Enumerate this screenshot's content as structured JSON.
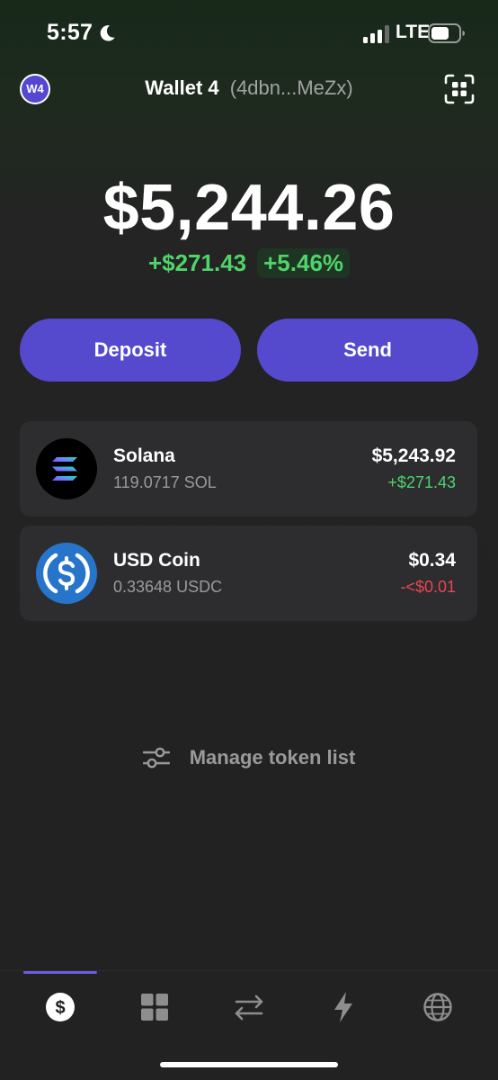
{
  "status_bar": {
    "time": "5:57",
    "network": "LTE",
    "icons": [
      "moon-icon",
      "signal-icon",
      "battery-icon"
    ]
  },
  "header": {
    "avatar_label": "W4",
    "wallet_name": "Wallet 4",
    "wallet_address": "(4dbn...MeZx)",
    "scan_icon": "qr-scan-icon"
  },
  "balance": {
    "total": "$5,244.26",
    "change_amount": "+$271.43",
    "change_percent": "+5.46%"
  },
  "actions": {
    "deposit_label": "Deposit",
    "send_label": "Send"
  },
  "tokens": [
    {
      "name": "Solana",
      "amount": "119.0717 SOL",
      "value": "$5,243.92",
      "change": "+$271.43",
      "direction": "up",
      "icon": "solana-logo-icon"
    },
    {
      "name": "USD Coin",
      "amount": "0.33648 USDC",
      "value": "$0.34",
      "change": "-<$0.01",
      "direction": "down",
      "icon": "usdc-logo-icon"
    }
  ],
  "manage": {
    "label": "Manage token list",
    "icon": "sliders-icon"
  },
  "bottom_nav": {
    "items": [
      {
        "icon": "dollar-icon",
        "active": true
      },
      {
        "icon": "grid-icon",
        "active": false
      },
      {
        "icon": "swap-arrows-icon",
        "active": false
      },
      {
        "icon": "lightning-icon",
        "active": false
      },
      {
        "icon": "globe-icon",
        "active": false
      }
    ]
  },
  "colors": {
    "accent": "#5549cd",
    "positive": "#4fd46a",
    "negative": "#e5484d",
    "card": "#2d2d30",
    "background": "#222222"
  }
}
